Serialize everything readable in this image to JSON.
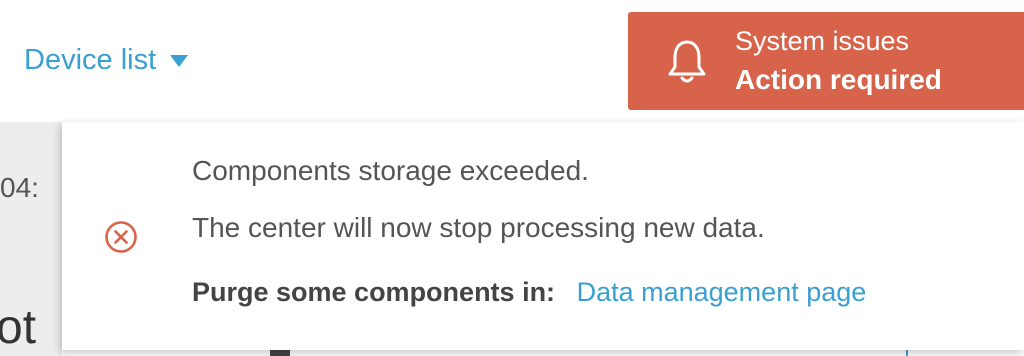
{
  "header": {
    "device_list_label": "Device list",
    "device_list_caret_icon": "caret-down-icon"
  },
  "system_issues": {
    "title": "System issues",
    "subtitle": "Action required",
    "icon": "bell-icon",
    "background_color": "#d7634a"
  },
  "background": {
    "time_fragment": "04:",
    "heading_fragment": "ot"
  },
  "notification": {
    "icon": "error-circle-x-icon",
    "icon_color": "#d7634a",
    "message_line1": "Components storage exceeded.",
    "message_line2": "The center will now stop processing new data.",
    "purge_label": "Purge some components in:",
    "purge_link": "Data management page",
    "link_color": "#3a9fd1"
  }
}
